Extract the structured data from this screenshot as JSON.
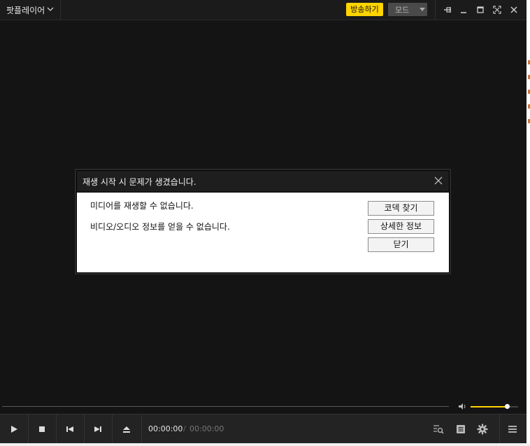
{
  "window": {
    "title": "팟플레이어",
    "broadcast_button": "방송하기",
    "mode_select": "모드"
  },
  "dialog": {
    "title": "재생 시작 시 문제가 생겼습니다.",
    "messages": [
      "미디어를 재생할 수 없습니다.",
      "비디오/오디오 정보를 얻을 수 없습니다."
    ],
    "buttons": [
      "코덱 찾기",
      "상세한 정보",
      "닫기"
    ]
  },
  "playback": {
    "current_time": "00:00:00",
    "separator": "/",
    "total_time": "00:00:00",
    "volume_level": 0.76
  },
  "colors": {
    "accent": "#ffd400",
    "background": "#141414",
    "control_bar": "#232323"
  }
}
